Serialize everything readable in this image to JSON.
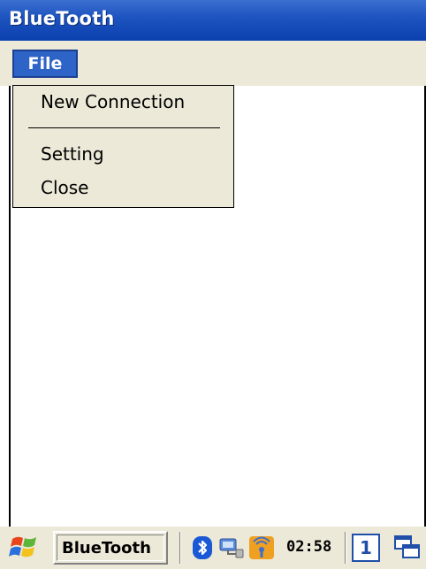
{
  "window": {
    "title": "BlueTooth"
  },
  "menubar": {
    "file_label": "File"
  },
  "dropdown": {
    "items": [
      "New Connection",
      "Setting",
      "Close"
    ]
  },
  "taskbar": {
    "app_button_label": "BlueTooth",
    "clock": "02:58",
    "input_indicator": "1",
    "icons": [
      "windows-flag-icon",
      "bluetooth-icon",
      "network-icon",
      "wireless-icon",
      "windows-switch-icon"
    ]
  },
  "colors": {
    "title_bar": "#1f55c0",
    "menu_bg": "#ece9d8",
    "menu_selected": "#2e63c7",
    "bluetooth_blue": "#1a58d6",
    "wireless_orange": "#f0a020"
  }
}
